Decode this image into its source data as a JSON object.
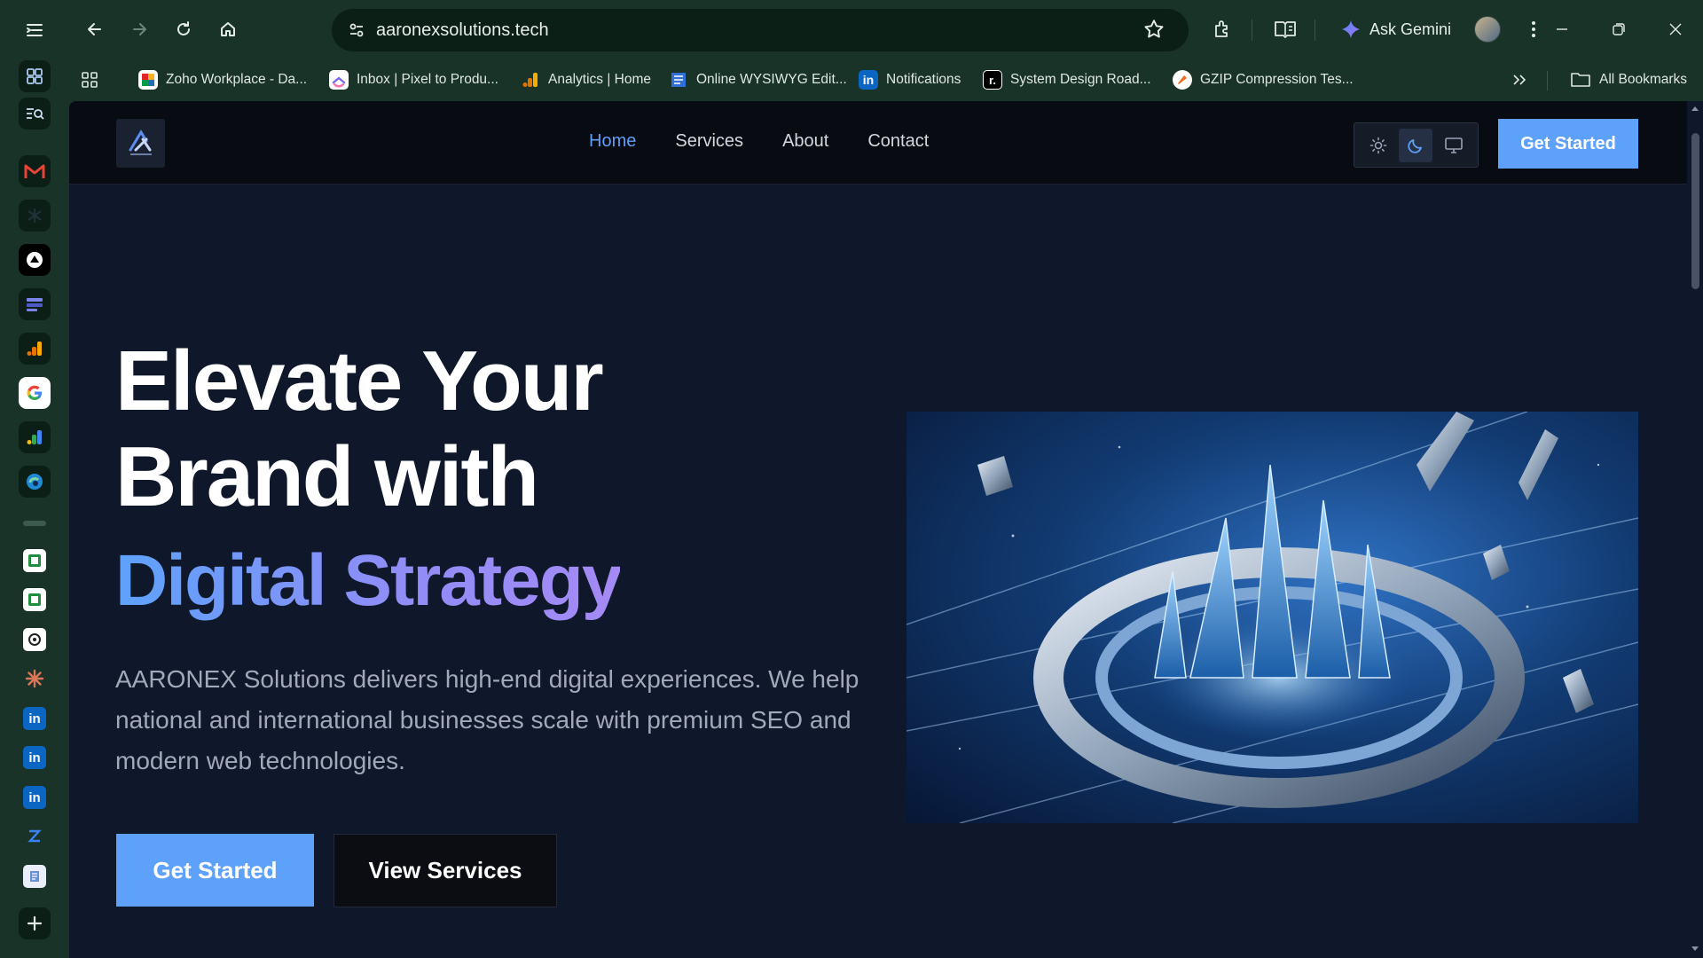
{
  "browser": {
    "url": "aaronexsolutions.tech",
    "gemini_label": "Ask Gemini",
    "bookmarks": [
      {
        "label": "Zoho Workplace - Da...",
        "icon": "zoho-icon"
      },
      {
        "label": "Inbox | Pixel to Produ...",
        "icon": "clickup-icon"
      },
      {
        "label": "Analytics | Home",
        "icon": "analytics-icon"
      },
      {
        "label": "Online WYSIWYG Edit...",
        "icon": "document-icon"
      },
      {
        "label": "Notifications",
        "icon": "linkedin-icon"
      },
      {
        "label": "System Design Road...",
        "icon": "roadmap-icon"
      },
      {
        "label": "GZIP Compression Tes...",
        "icon": "gzip-icon"
      }
    ],
    "all_bookmarks": "All Bookmarks",
    "side_panel_icons": [
      "tab-search-icon",
      "gmail-icon",
      "perplexity-icon",
      "vercel-icon",
      "teams-icon",
      "analytics-icon",
      "google-icon",
      "google-ads-icon",
      "edge-icon",
      "sheet-icon",
      "sheet-icon",
      "chatgpt-icon",
      "claude-icon",
      "linkedin-icon",
      "linkedin-icon",
      "linkedin-icon",
      "zed-icon",
      "notes-icon",
      "add-icon"
    ]
  },
  "site": {
    "nav": {
      "links": [
        "Home",
        "Services",
        "About",
        "Contact"
      ],
      "active": "Home",
      "cta": "Get Started",
      "theme_options": [
        "light",
        "dark",
        "system"
      ],
      "theme_selected": "dark"
    },
    "hero": {
      "title_line1": "Elevate Your",
      "title_line2": "Brand with",
      "title_highlight": "Digital Strategy",
      "description": "AARONEX Solutions delivers high-end digital experiences. We help national and international businesses scale with premium SEO and modern web technologies.",
      "primary_button": "Get Started",
      "secondary_button": "View Services"
    }
  },
  "colors": {
    "accent": "#5ea1fb",
    "gradient_end": "#a58af5",
    "page_bg": "#0f172a",
    "browser_frame": "#193328"
  }
}
